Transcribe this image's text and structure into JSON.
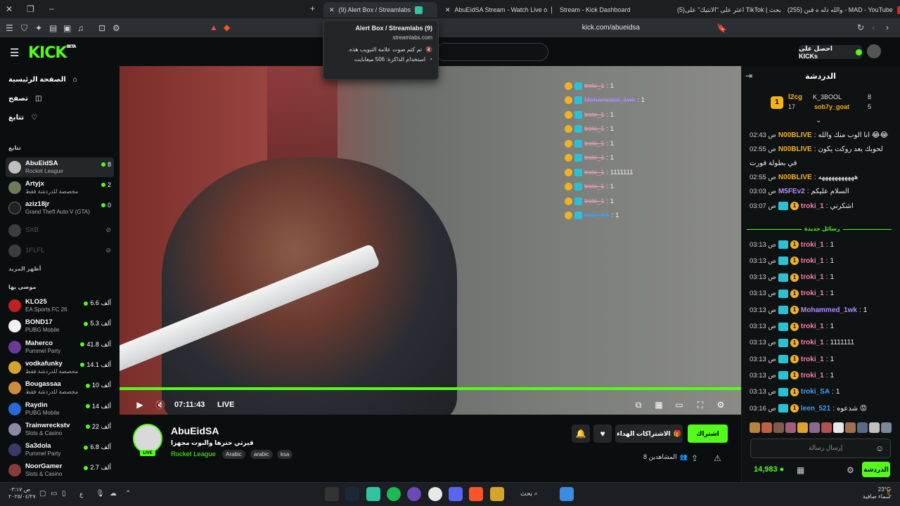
{
  "browser": {
    "tabs": [
      {
        "label": "(9) Alert Box / Streamlabs",
        "active": true
      },
      {
        "label": "AbuEidSA Stream - Watch Live o",
        "active": false
      },
      {
        "label": "Stream - Kick Dashboard",
        "active": false
      },
      {
        "label": "(5)اعثر على \"الانتيك\" على TikTok | بحث",
        "active": false
      },
      {
        "label": "(255) والله ذله ه قبن - MAD - YouTube",
        "active": false
      }
    ],
    "url": "kick.com/abueidsa",
    "popup": {
      "title": "(9) Alert Box / Streamlabs",
      "domain": "streamlabs.com",
      "muted": "تم كتم صوت علامة التبويب هذه.",
      "memory": "استخدام الذاكرة: 506 ميغابايت"
    }
  },
  "kick": {
    "logo": "KICK",
    "logo_beta": "BETA",
    "get_kicks": "احصل على KICKs"
  },
  "sidebar": {
    "nav": [
      {
        "label": "الصفحة الرئيسية",
        "icon": "home-icon"
      },
      {
        "label": "تصفح",
        "icon": "browse-icon"
      },
      {
        "label": "تتابع",
        "icon": "heart-icon"
      }
    ],
    "following_title": "تتابع",
    "following": [
      {
        "name": "AbuEidSA",
        "game": "Rocket League",
        "viewers": "8",
        "live": true
      },
      {
        "name": "Artyjx",
        "game": "مخصصة للدردشة فقط",
        "viewers": "2",
        "live": true
      },
      {
        "name": "aziz18jr",
        "game": "Grand Theft Auto V (GTA)",
        "viewers": "0",
        "live": true
      },
      {
        "name": "SXB",
        "game": "",
        "viewers": "",
        "live": false
      },
      {
        "name": "1FLFL",
        "game": "",
        "viewers": "",
        "live": false
      }
    ],
    "show_more": "أظهر المزيد",
    "recommended_title": "موصى بها",
    "recommended": [
      {
        "name": "KLO25",
        "game": "EA Sports FC 26",
        "viewers": "6.6 ألف"
      },
      {
        "name": "BOND17",
        "game": "PUBG Mobile",
        "viewers": "5.3 ألف"
      },
      {
        "name": "Maherco",
        "game": "Pummel Party",
        "viewers": "41.8 ألف"
      },
      {
        "name": "vodkafunky",
        "game": "مخصصة للدردشة فقط",
        "viewers": "14.1 ألف"
      },
      {
        "name": "Bougassaa",
        "game": "مخصصة للدردشة فقط",
        "viewers": "10 ألف"
      },
      {
        "name": "Raydin",
        "game": "PUBG Mobile",
        "viewers": "14 ألف"
      },
      {
        "name": "Trainwreckstv",
        "game": "Slots & Casino",
        "viewers": "22 ألف"
      },
      {
        "name": "Sa3dola",
        "game": "Pummel Party",
        "viewers": "6.8 ألف"
      },
      {
        "name": "NoorGamer",
        "game": "Slots & Casino",
        "viewers": "2.7 ألف"
      }
    ]
  },
  "player": {
    "time": "07:11:43",
    "live_label": "LIVE",
    "overlay_chat": [
      {
        "user": "troki_1",
        "text": ": 1"
      },
      {
        "user": "Mohammed_1wk",
        "text": ": 1"
      },
      {
        "user": "troki_1",
        "text": ": 1"
      },
      {
        "user": "troki_1",
        "text": ": 1"
      },
      {
        "user": "troki_1",
        "text": ": 1"
      },
      {
        "user": "troki_1",
        "text": ": 1"
      },
      {
        "user": "troki_1",
        "text": ": 1111111"
      },
      {
        "user": "troki_1",
        "text": ": 1"
      },
      {
        "user": "troki_1",
        "text": ": 1"
      },
      {
        "user": "troki_SA",
        "text": ": 1"
      }
    ]
  },
  "channel": {
    "name": "AbuEidSA",
    "title": "قيرتي حترها والبوت مجهزا",
    "category": "Rocket League",
    "tags": [
      "Arabic",
      "arabic",
      "ksa"
    ],
    "live_badge": "LIVE",
    "subscribe": "اشتراك",
    "gift_subs": "الاشتراكات الهداء",
    "viewers": "8 المشاهدين"
  },
  "chat": {
    "title": "الدردشة",
    "leaderboard": [
      {
        "rank": "1",
        "name": "l2cg",
        "count": "17"
      },
      {
        "name": "K_3BOOL",
        "count": "8"
      },
      {
        "name": "sob7y_goat",
        "count": "5"
      }
    ],
    "messages": [
      {
        "time": "02:43 ص",
        "user": "N00BLIVE",
        "color": "#f3b21c",
        "text": "انا الوب منك والله 😂😂"
      },
      {
        "time": "02:55 ص",
        "user": "N00BLIVE",
        "color": "#f3b21c",
        "text": "لحوبك بعد روكت يكون"
      },
      {
        "time": "",
        "user": "",
        "color": "",
        "text": "في بطولة فورت"
      },
      {
        "time": "02:55 ص",
        "user": "N00BLIVE",
        "color": "#f3b21c",
        "text": "هههههههههههه"
      },
      {
        "time": "03:03 ص",
        "user": "M5FEv2",
        "color": "#b18cff",
        "text": "السلام عليكم"
      },
      {
        "time": "03:07 ص",
        "user": "troki_1",
        "color": "#f47fb0",
        "text": "اشكرني"
      }
    ],
    "new_messages": "رسائل جديدة",
    "messages2": [
      {
        "time": "03:13 ص",
        "user": "troki_1",
        "color": "#f47fb0",
        "text": "1"
      },
      {
        "time": "03:13 ص",
        "user": "troki_1",
        "color": "#f47fb0",
        "text": "1"
      },
      {
        "time": "03:13 ص",
        "user": "troki_1",
        "color": "#f47fb0",
        "text": "1"
      },
      {
        "time": "03:13 ص",
        "user": "troki_1",
        "color": "#f47fb0",
        "text": "1"
      },
      {
        "time": "03:13 ص",
        "user": "Mohammed_1wk",
        "color": "#b18cff",
        "text": "1"
      },
      {
        "time": "03:13 ص",
        "user": "troki_1",
        "color": "#f47fb0",
        "text": "1"
      },
      {
        "time": "03:13 ص",
        "user": "troki_1",
        "color": "#f47fb0",
        "text": "1111111"
      },
      {
        "time": "03:13 ص",
        "user": "troki_1",
        "color": "#f47fb0",
        "text": "1"
      },
      {
        "time": "03:13 ص",
        "user": "troki_1",
        "color": "#f47fb0",
        "text": "1"
      },
      {
        "time": "03:13 ص",
        "user": "troki_SA",
        "color": "#3aa0ff",
        "text": "1"
      },
      {
        "time": "03:16 ص",
        "user": "leen_521",
        "color": "#3aa0ff",
        "text": "شدعوه 😡"
      }
    ],
    "input_placeholder": "إرسال رسالة",
    "kicks": "14,983",
    "send": "الدردشة"
  },
  "taskbar": {
    "time": "۰۳:۱۷ ص",
    "date": "۲۰۲٥/٠٤/٢٧",
    "search": "بحث",
    "weather_temp": "23°C",
    "weather_desc": "سماء صافية",
    "lang": "ع"
  },
  "colors": {
    "accent": "#53fc18",
    "bg": "#0b0e0f"
  }
}
